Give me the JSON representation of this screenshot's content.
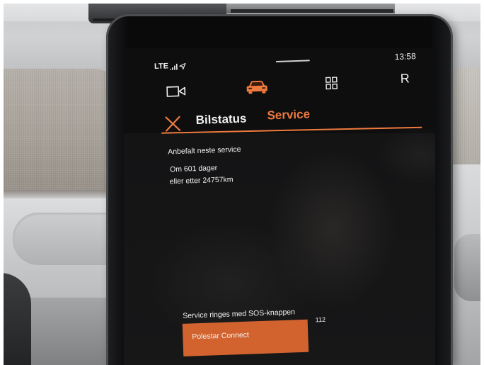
{
  "status_bar": {
    "network": "LTE",
    "time": "13:58",
    "icons": {
      "signal": "signal-bars-icon",
      "location": "location-arrow-icon"
    }
  },
  "nav": {
    "items": [
      {
        "icon": "video-camera-icon"
      },
      {
        "icon": "car-icon",
        "active": true
      },
      {
        "icon": "app-grid-icon"
      },
      {
        "label": "R"
      }
    ]
  },
  "header": {
    "close_icon": "close-icon",
    "title": "Bilstatus",
    "active_tab": "Service"
  },
  "service": {
    "heading": "Anbefalt neste service",
    "days": "Om 601 dager",
    "distance": "eller etter 24757km"
  },
  "sos": {
    "label": "Service ringes med SOS-knappen",
    "button_label": "Polestar Connect",
    "emergency_number": "112"
  },
  "colors": {
    "accent": "#ef7a3e",
    "button": "#d2632f",
    "screen": "#0e0e0f",
    "text": "#f1f1f1"
  }
}
